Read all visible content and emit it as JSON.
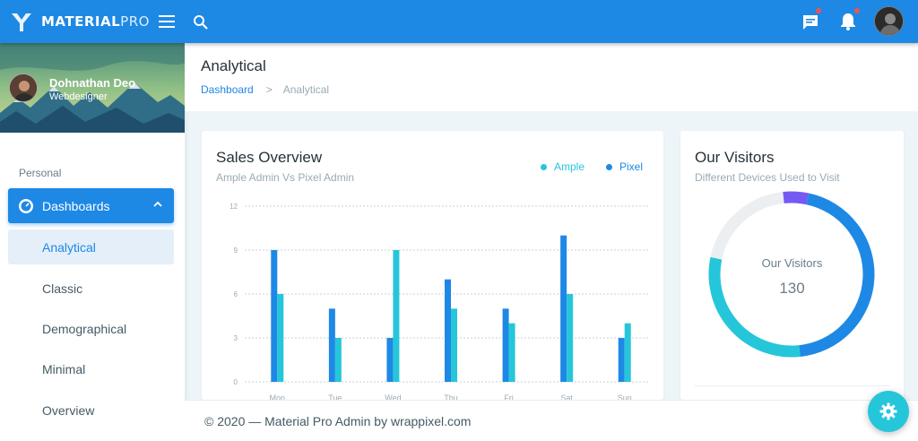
{
  "brand": {
    "name_bold": "MATERIAL",
    "name_light": "PRO"
  },
  "topbar": {
    "icons": [
      "menu-icon",
      "search-icon",
      "message-icon",
      "bell-icon"
    ]
  },
  "sidebar": {
    "user": {
      "name": "Dohnathan Deo",
      "role": "Webdesigner"
    },
    "heading": "Personal",
    "dashboards_label": "Dashboards",
    "items": [
      {
        "label": "Analytical",
        "active": true
      },
      {
        "label": "Classic",
        "active": false
      },
      {
        "label": "Demographical",
        "active": false
      },
      {
        "label": "Minimal",
        "active": false
      },
      {
        "label": "Overview",
        "active": false
      }
    ]
  },
  "page": {
    "title": "Analytical",
    "breadcrumb": {
      "link": "Dashboard",
      "separator": ">",
      "current": "Analytical"
    }
  },
  "sales": {
    "title": "Sales Overview",
    "subtitle": "Ample Admin Vs Pixel Admin",
    "legend": [
      {
        "name": "Ample",
        "color": "#26c6da"
      },
      {
        "name": "Pixel",
        "color": "#1e88e5"
      }
    ]
  },
  "visitors": {
    "title": "Our Visitors",
    "subtitle": "Different Devices Used to Visit",
    "center_label": "Our Visitors",
    "center_value": "130"
  },
  "footer": {
    "text": "© 2020 — Material Pro Admin by wrappixel.com"
  },
  "chart_data": [
    {
      "type": "bar",
      "categories": [
        "Mon",
        "Tue",
        "Wed",
        "Thu",
        "Fri",
        "Sat",
        "Sun"
      ],
      "series": [
        {
          "name": "Pixel",
          "color": "#1e88e5",
          "values": [
            9,
            5,
            3,
            7,
            5,
            10,
            3
          ]
        },
        {
          "name": "Ample",
          "color": "#26c6da",
          "values": [
            6,
            3,
            9,
            5,
            4,
            6,
            4
          ]
        }
      ],
      "yticks": [
        "0",
        "3",
        "6",
        "9",
        "12"
      ],
      "ylim": [
        0,
        12
      ],
      "grid": true
    },
    {
      "type": "pie",
      "donut": true,
      "slices": [
        {
          "value": 45,
          "color": "#1e88e5"
        },
        {
          "value": 30,
          "color": "#26c6da"
        },
        {
          "value": 20,
          "color": "#eceff1"
        },
        {
          "value": 5,
          "color": "#745af2"
        }
      ]
    }
  ]
}
